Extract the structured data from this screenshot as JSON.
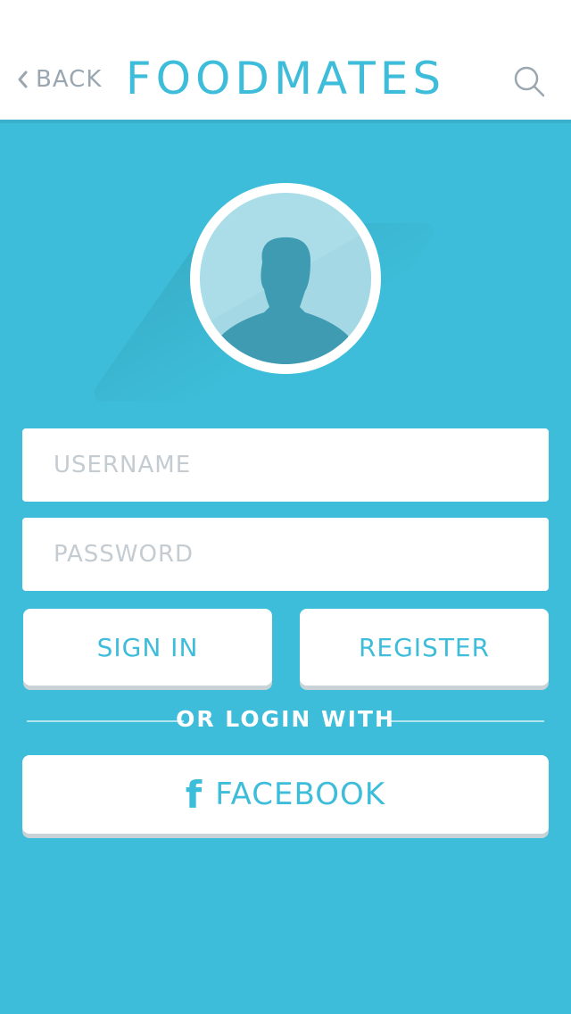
{
  "header": {
    "back_label": "BACK",
    "title": "FOODMATES",
    "back_icon": "chevron-left-icon",
    "search_icon": "search-icon"
  },
  "avatar": {
    "icon": "user-silhouette-icon"
  },
  "form": {
    "username_placeholder": "USERNAME",
    "password_placeholder": "PASSWORD",
    "username_value": "",
    "password_value": ""
  },
  "actions": {
    "sign_in_label": "SIGN IN",
    "register_label": "REGISTER",
    "divider_label": "OR LOGIN WITH",
    "facebook_label": "FACEBOOK",
    "facebook_icon": "facebook-icon",
    "facebook_glyph": "f"
  },
  "colors": {
    "background": "#3dbdd9",
    "accent": "#3dbdd9",
    "surface": "#ffffff",
    "placeholder": "#c4cbd1",
    "muted": "#9aa7b1"
  }
}
